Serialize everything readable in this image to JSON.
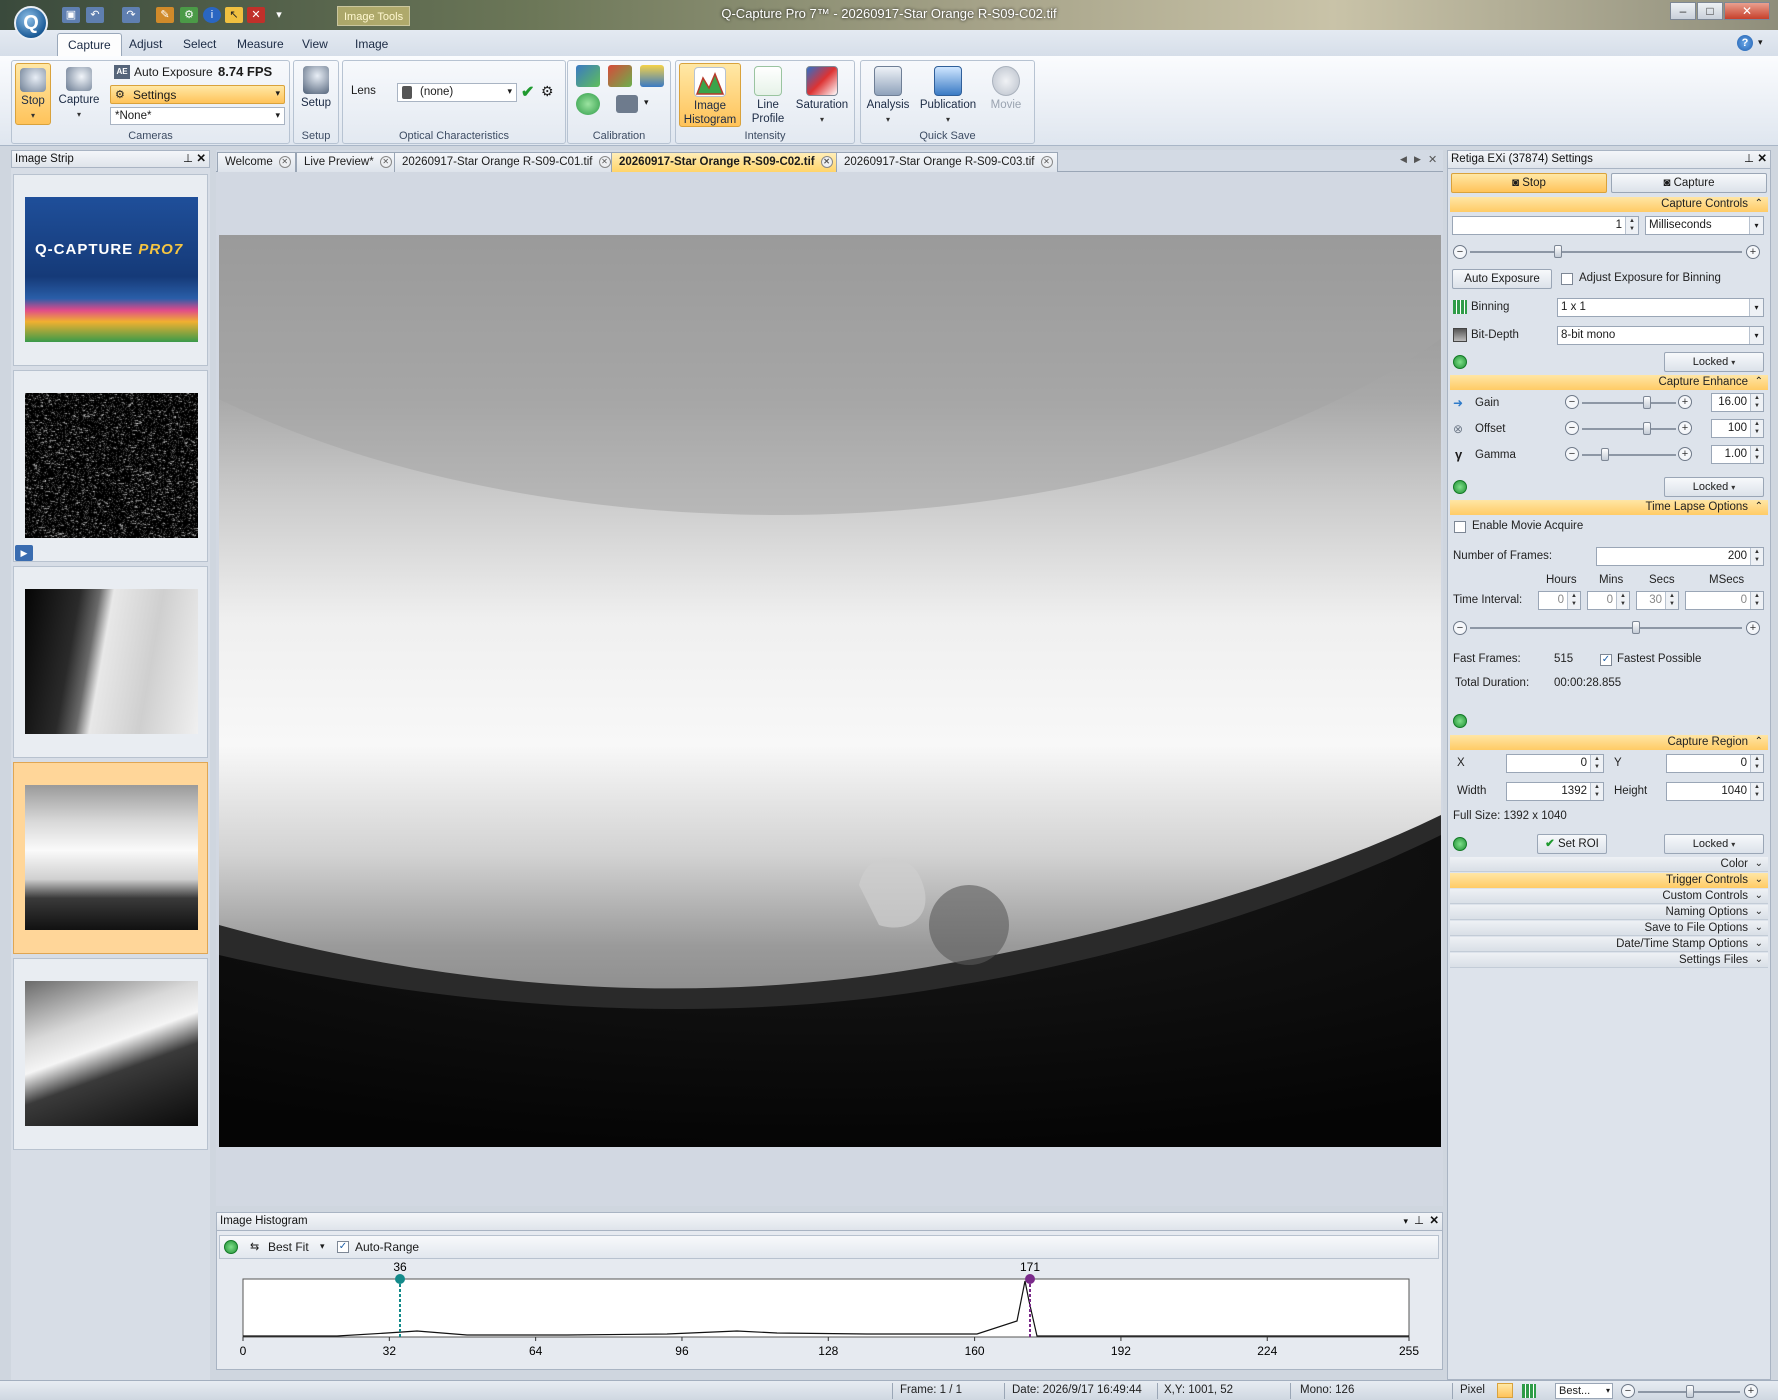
{
  "window": {
    "title": "Q-Capture Pro 7™ - 20260917-Star Orange R-S09-C02.tif",
    "context_tab": "Image Tools"
  },
  "ribbon_tabs": [
    "Capture",
    "Adjust",
    "Select",
    "Measure",
    "View",
    "Image"
  ],
  "ribbon": {
    "cameras": {
      "stop": "Stop",
      "capture": "Capture",
      "auto_exposure": "Auto Exposure",
      "fps": "8.74 FPS",
      "settings": "Settings",
      "preset": "*None*",
      "label": "Cameras"
    },
    "setup": {
      "button": "Setup",
      "label": "Setup"
    },
    "optical": {
      "lens_label": "Lens",
      "lens_value": "(none)",
      "label": "Optical Characteristics"
    },
    "calibration": {
      "label": "Calibration"
    },
    "intensity": {
      "histogram": "Image Histogram",
      "line_profile": "Line Profile",
      "saturation": "Saturation",
      "label": "Intensity"
    },
    "quick_save": {
      "analysis": "Analysis",
      "publication": "Publication",
      "movie": "Movie",
      "label": "Quick Save"
    }
  },
  "image_strip": {
    "title": "Image Strip",
    "banner_brand": "Q-CAPTURE",
    "banner_version": "PRO7"
  },
  "doc_tabs": [
    {
      "label": "Welcome"
    },
    {
      "label": "Live Preview*"
    },
    {
      "label": "20260917-Star Orange R-S09-C01.tif"
    },
    {
      "label": "20260917-Star Orange R-S09-C02.tif"
    },
    {
      "label": "20260917-Star Orange R-S09-C03.tif"
    }
  ],
  "histogram_panel": {
    "title": "Image Histogram",
    "fit_mode": "Best Fit",
    "auto_range_label": "Auto-Range",
    "auto_range_checked": true,
    "low_marker": "36",
    "high_marker": "171",
    "x_ticks": [
      "0",
      "32",
      "64",
      "96",
      "128",
      "160",
      "192",
      "224",
      "255"
    ]
  },
  "settings_panel": {
    "title": "Retiga EXi (37874) Settings",
    "stop": "Stop",
    "capture": "Capture",
    "capture_controls": {
      "title": "Capture Controls",
      "exposure_value": "1",
      "exposure_unit": "Milliseconds",
      "auto_exposure": "Auto Exposure",
      "adjust_binning_label": "Adjust Exposure for Binning",
      "adjust_binning_checked": false,
      "binning_label": "Binning",
      "binning_value": "1 x 1",
      "bitdepth_label": "Bit-Depth",
      "bitdepth_value": "8-bit mono",
      "lock": "Locked"
    },
    "capture_enhance": {
      "title": "Capture Enhance",
      "gain_label": "Gain",
      "gain_value": "16.00",
      "offset_label": "Offset",
      "offset_value": "100",
      "gamma_label": "Gamma",
      "gamma_value": "1.00",
      "lock": "Locked"
    },
    "time_lapse": {
      "title": "Time Lapse Options",
      "enable_movie_label": "Enable Movie Acquire",
      "enable_movie_checked": false,
      "frames_label": "Number of  Frames:",
      "frames_value": "200",
      "hours_label": "Hours",
      "mins_label": "Mins",
      "secs_label": "Secs",
      "msecs_label": "MSecs",
      "interval_label": "Time Interval:",
      "hours": "0",
      "mins": "0",
      "secs": "30",
      "msecs": "0",
      "fast_frames_label": "Fast Frames:",
      "fast_frames_value": "515",
      "fastest_label": "Fastest Possible",
      "fastest_checked": true,
      "duration_label": "Total Duration:",
      "duration_value": "00:00:28.855"
    },
    "capture_region": {
      "title": "Capture Region",
      "x_label": "X",
      "x_value": "0",
      "y_label": "Y",
      "y_value": "0",
      "width_label": "Width",
      "width_value": "1392",
      "height_label": "Height",
      "height_value": "1040",
      "full_size": "Full Size: 1392 x 1040",
      "set_roi": "Set ROI",
      "lock": "Locked"
    },
    "collapsed_sections": [
      "Color",
      "Trigger Controls",
      "Custom Controls",
      "Naming Options",
      "Save to File Options",
      "Date/Time Stamp Options",
      "Settings Files"
    ]
  },
  "status_bar": {
    "frame": "Frame: 1 / 1",
    "date": "Date: 2026/9/17 16:49:44",
    "xy": "X,Y: 1001,   52",
    "mono": "Mono:  126",
    "unit": "Pixel",
    "zoom": "Best..."
  },
  "colors": {
    "accent": "#ffcb66",
    "ribbon_bg": "#dfe6ef",
    "active_tab": "#ffd46a"
  }
}
